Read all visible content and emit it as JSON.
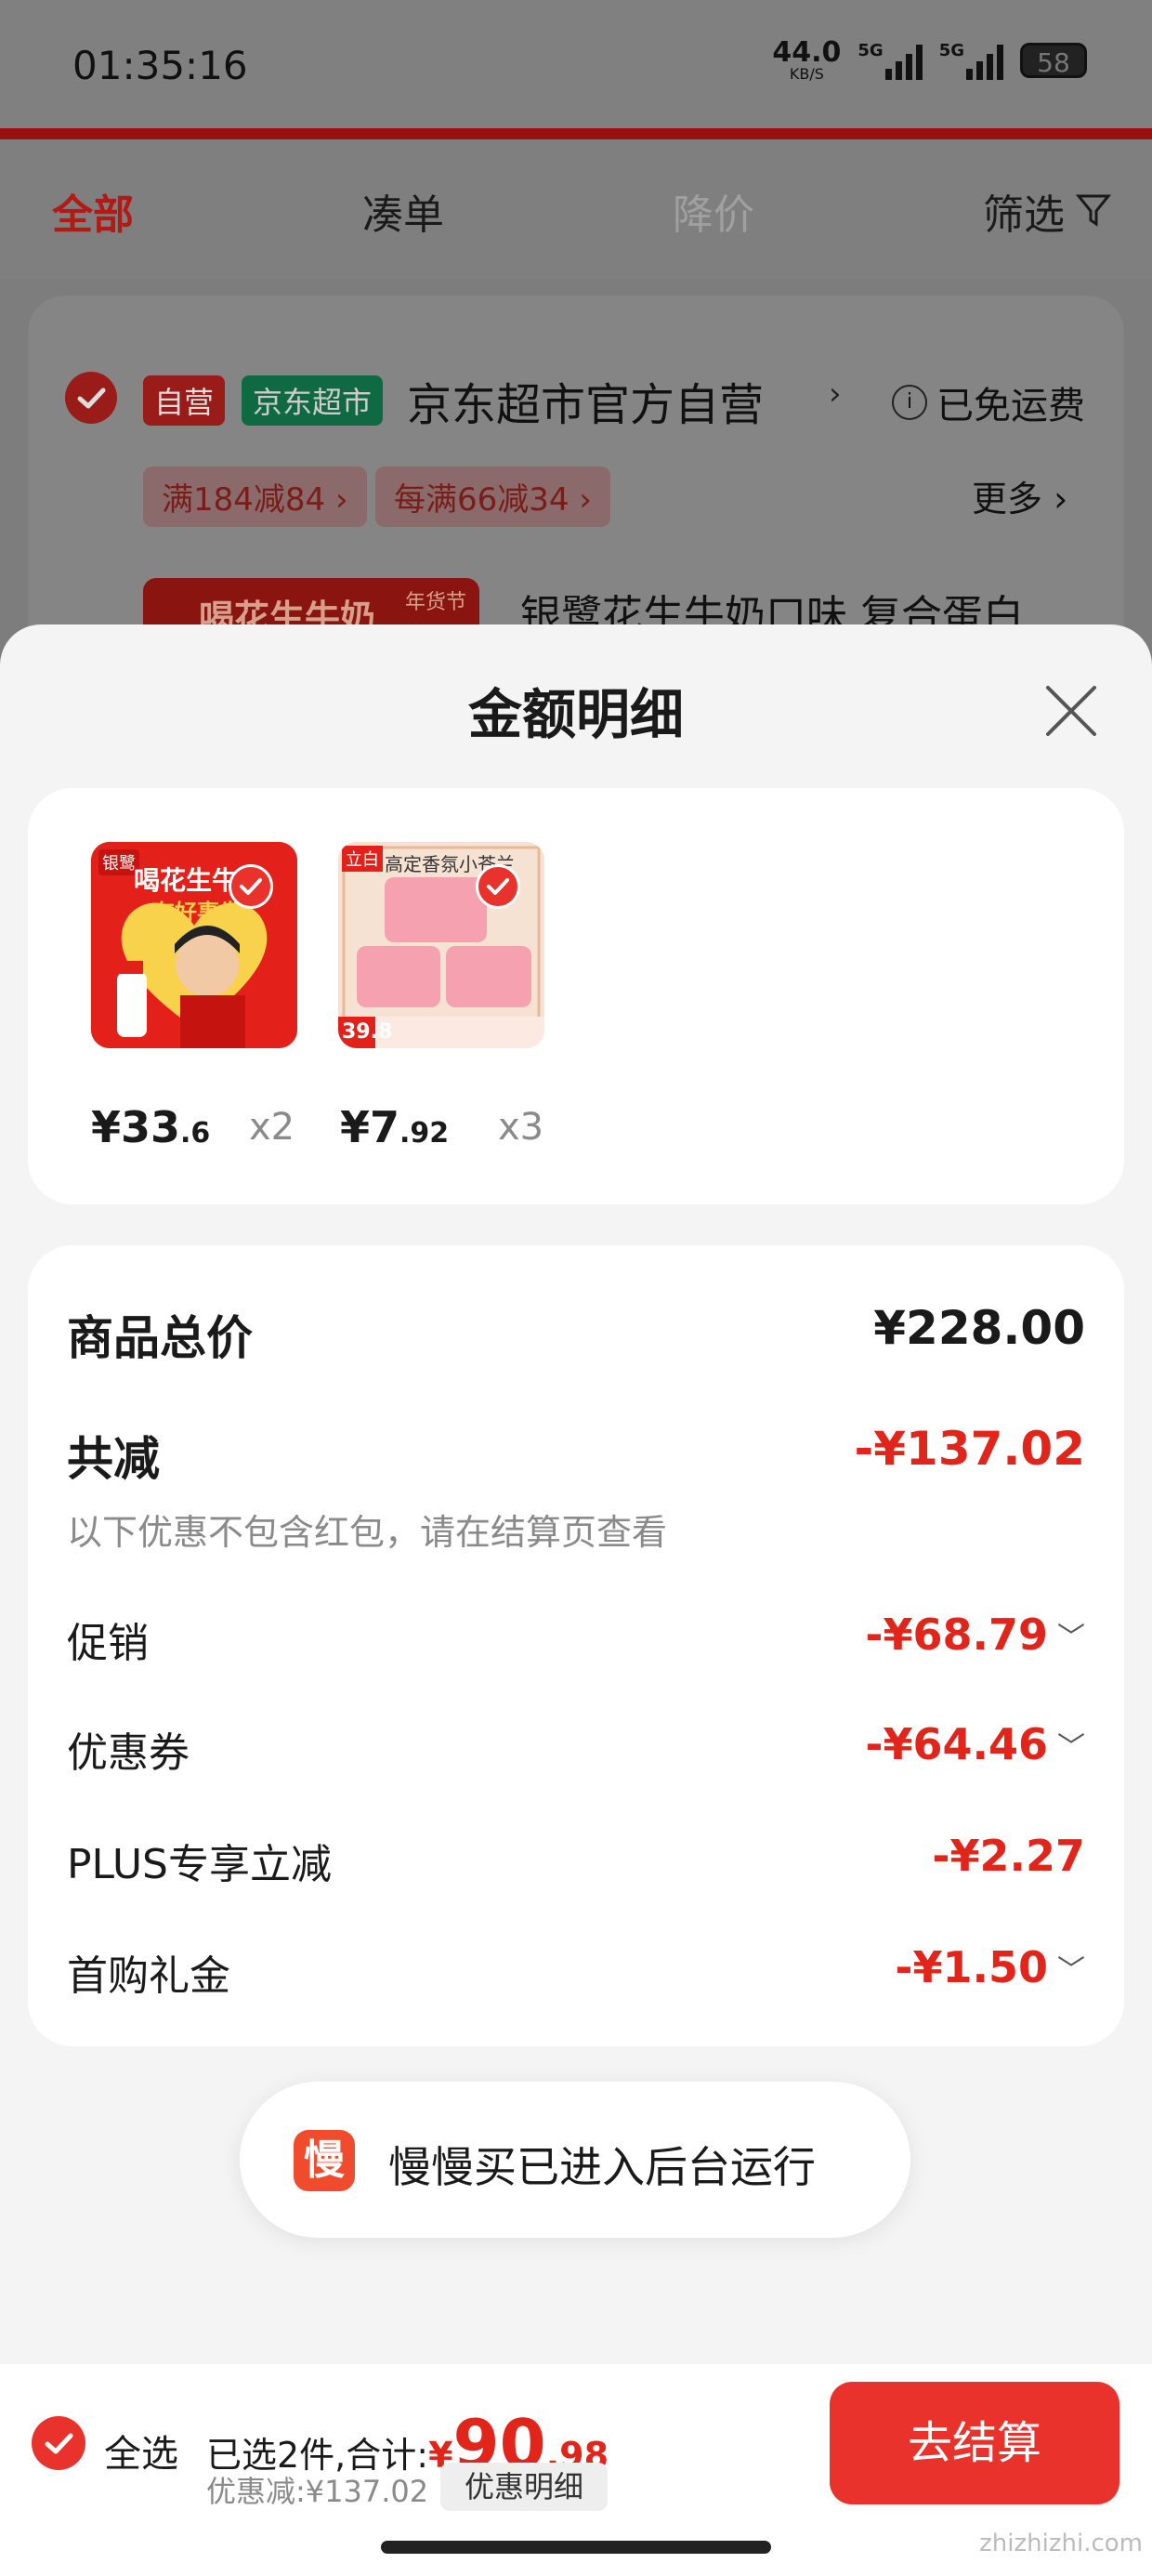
{
  "status_bar": {
    "time": "01:35:16",
    "net_speed": "44.0",
    "net_unit": "KB/S",
    "signal1": "5G",
    "signal2": "5G",
    "battery": "58"
  },
  "tabs": [
    {
      "label": "全部",
      "state": "active"
    },
    {
      "label": "凑单",
      "state": "normal"
    },
    {
      "label": "降价",
      "state": "disabled"
    },
    {
      "label": "筛选",
      "state": "normal"
    }
  ],
  "background_shop": {
    "badge_self": "自营",
    "badge_market": "京东超市",
    "shop_name": "京东超市官方自营",
    "shipping": "已免运费",
    "promo1": "满184减84",
    "promo2": "每满66减34",
    "more": "更多",
    "product_title_partial": "银鹭花生牛奶口味 复合蛋白",
    "banner_text": "喝花生牛奶",
    "banner_tag": "年货节"
  },
  "sheet": {
    "title": "金额明细",
    "products": [
      {
        "price_int": "¥33",
        "price_dec": ".6",
        "qty": "x2",
        "thumb_text1": "喝花生牛奶",
        "thumb_text2": "有好事发",
        "brand": "银鹭"
      },
      {
        "price_int": "¥7",
        "price_dec": ".92",
        "qty": "x3",
        "thumb_text1": "高定香氛小苍兰",
        "thumb_brand": "立白",
        "thumb_price": "39.8"
      }
    ],
    "total_label": "商品总价",
    "total_value": "¥228.00",
    "discount_label": "共减",
    "discount_value": "-¥137.02",
    "discount_note": "以下优惠不包含红包，请在结算页查看",
    "rows": [
      {
        "label": "促销",
        "value": "-¥68.79",
        "expandable": true
      },
      {
        "label": "优惠券",
        "value": "-¥64.46",
        "expandable": true
      },
      {
        "label": "PLUS专享立减",
        "value": "-¥2.27",
        "expandable": false
      },
      {
        "label": "首购礼金",
        "value": "-¥1.50",
        "expandable": true
      }
    ]
  },
  "toast": {
    "icon_char": "慢",
    "text": "慢慢买已进入后台运行"
  },
  "bottom_bar": {
    "select_all": "全选",
    "selected_summary": "已选2件,合计:",
    "currency": "¥",
    "total_int": "90",
    "total_dec": ".98",
    "saved": "优惠减:¥137.02",
    "detail_button": "优惠明细",
    "checkout_button": "去结算"
  },
  "watermark": "zhizhizhi.com",
  "colors": {
    "accent_red": "#e8322b",
    "discount_red": "#e1251b",
    "self_badge": "#e8322b",
    "market_badge": "#1aa36a"
  }
}
